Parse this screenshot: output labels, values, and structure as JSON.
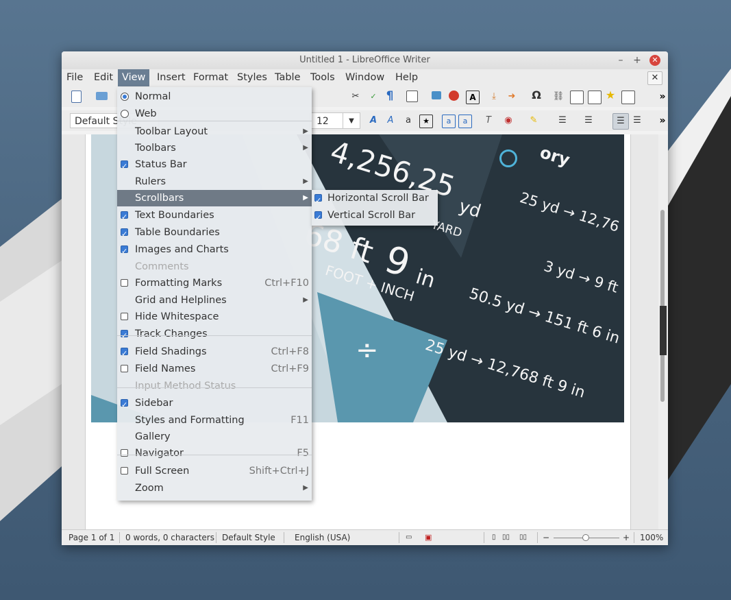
{
  "window": {
    "title": "Untitled 1 - LibreOffice Writer",
    "min": "–",
    "max": "+",
    "close": "✕",
    "doc_close": "✕"
  },
  "menubar": [
    "File",
    "Edit",
    "View",
    "Insert",
    "Format",
    "Styles",
    "Table",
    "Tools",
    "Window",
    "Help"
  ],
  "toolbar": {
    "paragraph_style": "Default Style",
    "font_size": "12",
    "more": "»"
  },
  "view_menu": [
    {
      "label": "Normal",
      "mark": "radio-on"
    },
    {
      "label": "Web",
      "mark": "radio-off"
    },
    {
      "label": "Toolbar Layout",
      "submenu": true
    },
    {
      "label": "Toolbars",
      "submenu": true
    },
    {
      "label": "Status Bar",
      "mark": "check-on"
    },
    {
      "label": "Rulers",
      "submenu": true
    },
    {
      "label": "Scrollbars",
      "submenu": true,
      "highlighted": true
    },
    {
      "label": "Text Boundaries",
      "mark": "check-on"
    },
    {
      "label": "Table Boundaries",
      "mark": "check-on"
    },
    {
      "label": "Images and Charts",
      "mark": "check-on"
    },
    {
      "label": "Comments",
      "disabled": true
    },
    {
      "label": "Formatting Marks",
      "mark": "check-off",
      "shortcut": "Ctrl+F10"
    },
    {
      "label": "Grid and Helplines",
      "submenu": true
    },
    {
      "label": "Hide Whitespace",
      "mark": "check-off"
    },
    {
      "label": "Track Changes",
      "mark": "check-on"
    },
    {
      "label": "Field Shadings",
      "mark": "check-on",
      "shortcut": "Ctrl+F8"
    },
    {
      "label": "Field Names",
      "mark": "check-off",
      "shortcut": "Ctrl+F9"
    },
    {
      "label": "Input Method Status",
      "disabled": true
    },
    {
      "label": "Sidebar",
      "mark": "check-on"
    },
    {
      "label": "Styles and Formatting",
      "shortcut": "F11"
    },
    {
      "label": "Gallery"
    },
    {
      "label": "Navigator",
      "mark": "check-off",
      "shortcut": "F5"
    },
    {
      "label": "Full Screen",
      "mark": "check-off",
      "shortcut": "Shift+Ctrl+J"
    },
    {
      "label": "Zoom",
      "submenu": true
    }
  ],
  "scrollbars_submenu": [
    {
      "label": "Horizontal Scroll Bar",
      "mark": "check-on"
    },
    {
      "label": "Vertical Scroll Bar",
      "mark": "check-on"
    }
  ],
  "image_text": {
    "a": "4,256,25",
    "b": "yd",
    "c": "YARD",
    "d": "68 ft",
    "e": "9",
    "f": "in",
    "g": "FOOT + INCH",
    "h": "25 yd → 12,76",
    "i": "3 yd → 9 ft",
    "j": "50.5 yd → 151 ft 6 in",
    "k": "25 yd → 12,768 ft 9 in",
    "l": "ory",
    "m": "÷"
  },
  "statusbar": {
    "page": "Page 1 of 1",
    "words": "0 words, 0 characters",
    "style": "Default Style",
    "language": "English (USA)",
    "zoom": "100%"
  }
}
